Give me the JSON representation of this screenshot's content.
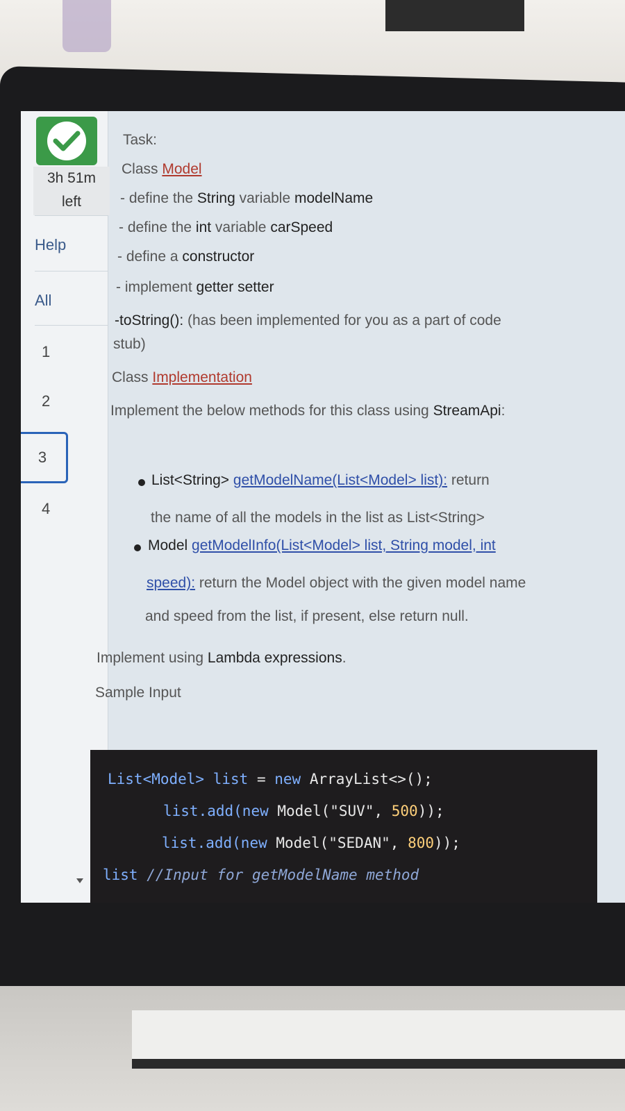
{
  "sidebar": {
    "timer": "3h 51m",
    "timer_suffix": "left",
    "help": "Help",
    "all": "All",
    "questions": [
      "1",
      "2",
      "3",
      "4"
    ],
    "active_question": "3"
  },
  "task": {
    "heading": "Task:",
    "class1_prefix": "Class ",
    "class1_name": "Model",
    "item1_pre": "- define the ",
    "item1_b1": "String",
    "item1_mid": " variable ",
    "item1_b2": "modelName",
    "item2_pre": "- define the ",
    "item2_b1": "int",
    "item2_mid": " variable ",
    "item2_b2": "carSpeed",
    "item3_pre": "- define a ",
    "item3_b": "constructor",
    "item4_pre": "- implement ",
    "item4_b": "getter setter",
    "item5_b": "-toString():",
    "item5_rest": " (has been implemented for you as a part of code",
    "item5_cont": "stub)",
    "class2_prefix": "Class ",
    "class2_name": "Implementation",
    "impl_pre": "Implement the below methods for this class using ",
    "impl_b": "StreamApi",
    "impl_post": ":",
    "m1_type": "List<String> ",
    "m1_sig": "getModelName(List<Model> list):",
    "m1_desc": " return",
    "m1_cont": "the name of all the models in the list as List<String>",
    "m2_type": "Model ",
    "m2_sig": "getModelInfo(List<Model> list, String model, int",
    "m2_sig2": "speed):",
    "m2_desc": " return the Model object with the given model name",
    "m2_cont": "and speed from the list, if present, else return null.",
    "lambda_pre": "Implement using ",
    "lambda_b": "Lambda expressions",
    "lambda_post": ".",
    "sample": "Sample Input"
  },
  "code": {
    "l1_a": "List<Model> list",
    "l1_b": " = ",
    "l1_c": "new",
    "l1_d": " ArrayList<>();",
    "l2_a": "list.add(",
    "l2_b": "new",
    "l2_c": " Model(",
    "l2_d": "\"SUV\"",
    "l2_e": ", ",
    "l2_f": "500",
    "l2_g": "));",
    "l3_a": "list.add(",
    "l3_b": "new",
    "l3_c": " Model(",
    "l3_d": "\"SEDAN\"",
    "l3_e": ", ",
    "l3_f": "800",
    "l3_g": "));",
    "l4_a": "list",
    "l4_b": " //Input for ",
    "l4_c": "getModelName",
    "l4_d": " method"
  }
}
